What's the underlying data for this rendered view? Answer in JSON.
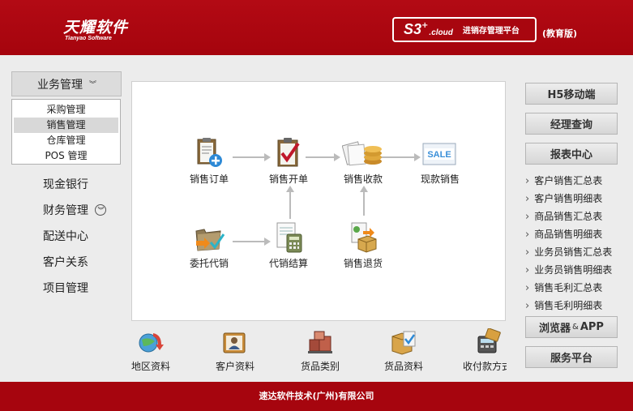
{
  "header": {
    "logo_cn": "天耀软件",
    "logo_en": "Tianyao Software",
    "product_code": "S3",
    "product_suffix": "cloud",
    "product_name": "进销存管理平台",
    "edition": "(教育版)"
  },
  "nav": {
    "group_title": "业务管理",
    "sub_items": [
      "采购管理",
      "销售管理",
      "仓库管理",
      "POS 管理"
    ],
    "active_sub": "销售管理",
    "items": [
      "现金银行",
      "财务管理",
      "配送中心",
      "客户关系",
      "项目管理"
    ]
  },
  "flow": {
    "sales_order": "销售订单",
    "sales_invoice": "销售开单",
    "sales_receipt": "销售收款",
    "cash_sale": "现款销售",
    "consignment": "委托代销",
    "consign_settle": "代销结算",
    "sales_return": "销售退货"
  },
  "shortcuts": [
    "地区资料",
    "客户资料",
    "货品类别",
    "货品资料",
    "收付款方式"
  ],
  "right": {
    "h5_button": "H5移动端",
    "manager_button": "经理查询",
    "report_center": "报表中心",
    "reports": [
      "客户销售汇总表",
      "客户销售明细表",
      "商品销售汇总表",
      "商品销售明细表",
      "业务员销售汇总表",
      "业务员销售明细表",
      "销售毛利汇总表",
      "销售毛利明细表"
    ],
    "browser_label": "浏览器",
    "browser_amp": "&",
    "browser_app": "APP",
    "service_button": "服务平台"
  },
  "footer": {
    "text": "速达软件技术(广州)有限公司"
  },
  "colors": {
    "brand_red": "#a6050e",
    "panel_bg": "#ececec"
  }
}
